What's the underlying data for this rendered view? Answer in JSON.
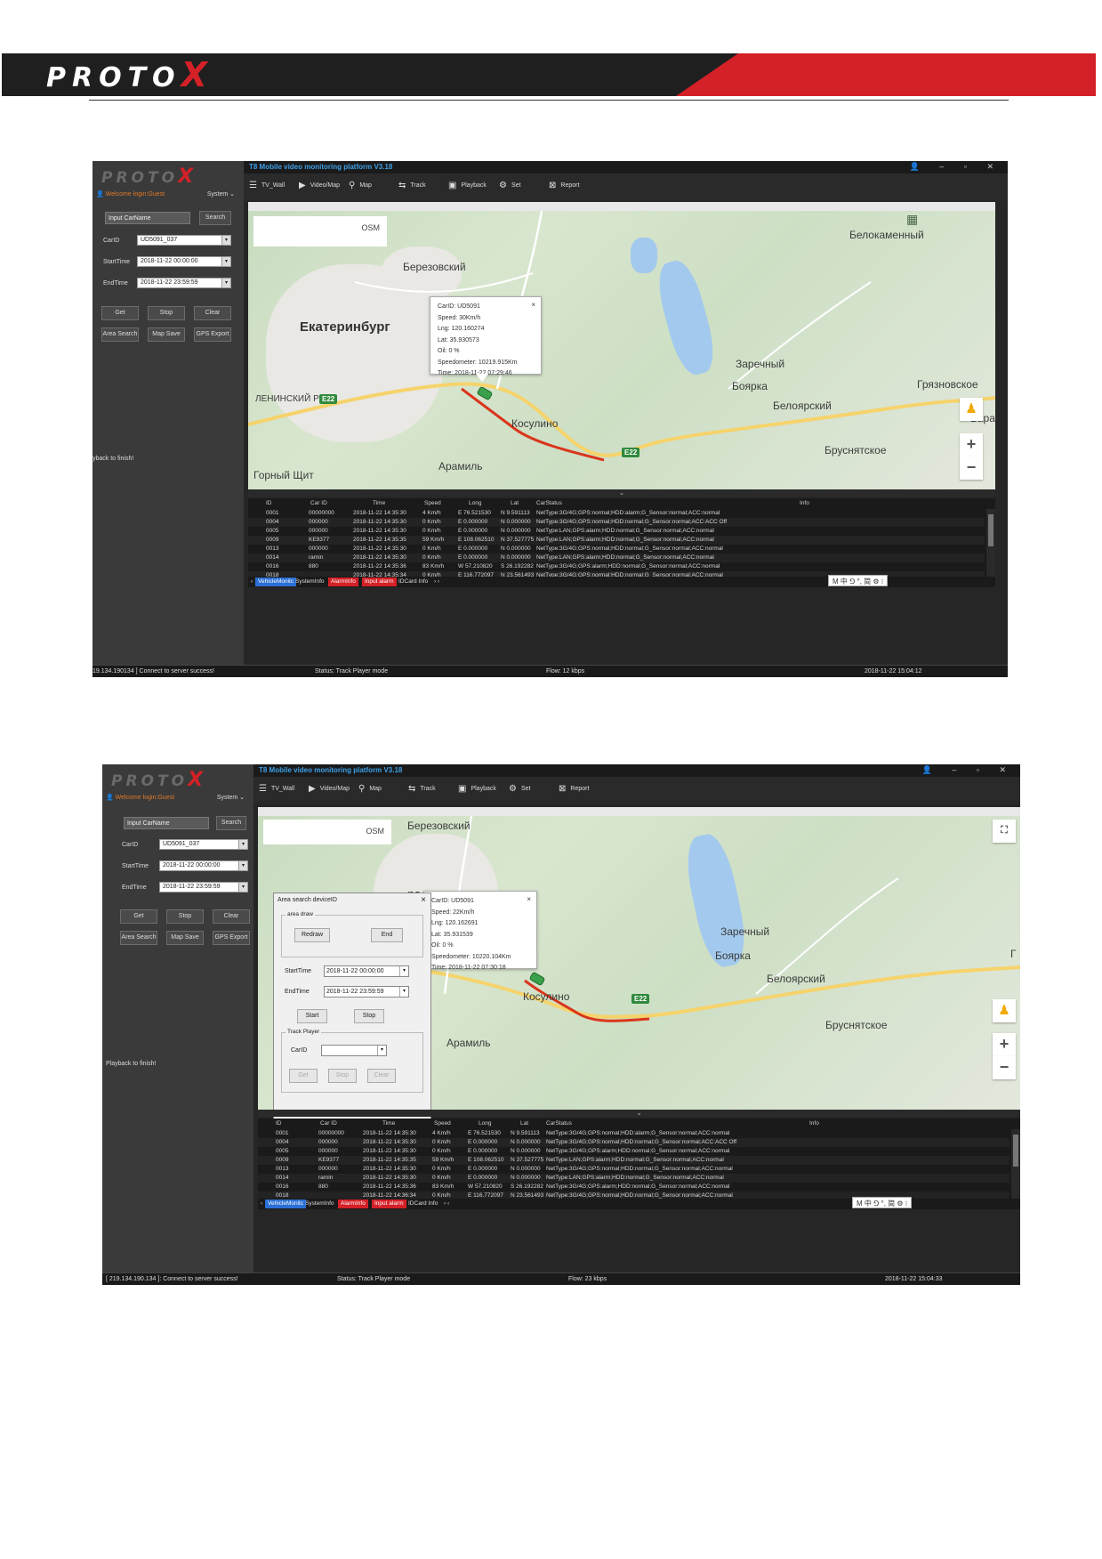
{
  "header": {
    "logo_text": "PROTO",
    "logo_x": "X"
  },
  "app": {
    "title": "T8 Mobile video monitoring platform V3.18",
    "logo_text": "PROTO",
    "logo_x": "X",
    "welcome": "Welcome login:Guest",
    "system_menu": "System",
    "search_placeholder": "Input CarName",
    "search_button": "Search",
    "car_id_label": "CarID",
    "start_time_label": "StartTime",
    "end_time_label": "EndTime",
    "car_id_value": "UD5091_037",
    "start_time_value": "2018-11-22 00:00:00",
    "end_time_value": "2018-11-22 23:59:59",
    "buttons": {
      "get": "Get",
      "stop": "Stop",
      "clear": "Clear",
      "area_search": "Area Search",
      "map_save": "Map Save",
      "gps_export": "GPS Export"
    },
    "toolbar": {
      "tv_wall": "TV_Wall",
      "video_map": "Video/Map",
      "map": "Map",
      "track": "Track",
      "playback": "Playback",
      "set": "Set",
      "report": "Report"
    },
    "map_source": "OSM",
    "table_headers": [
      "ID",
      "Car ID",
      "Time",
      "Speed",
      "Long",
      "Lat",
      "CarStatus",
      "Info"
    ],
    "tabs": [
      "VehicleMonitc",
      "SystemInfo",
      "AlarmInfo",
      "Input alarm",
      "IDCard Info"
    ],
    "ime": "M 中 ⅁ °, 简 ⚙ ⁝",
    "status_mode": "Status: Track Player mode"
  },
  "shot1": {
    "playback_msg": "yback to finish!",
    "server_msg": "19.134.190134 ] Connect to server success!",
    "flow": "Flow: 12 kbps",
    "datetime": "2018-11-22 15:04:12",
    "places": {
      "belokamenny": "Белокаменный",
      "berezovsky": "Березовский",
      "ekaterinburg": "Екатеринбург",
      "zarechny": "Заречный",
      "boyarka": "Боярка",
      "gryaznovskoe": "Грязновское",
      "leninsky": "ЛЕНИНСКИЙ Р-Н",
      "beloyarsky": "Белоярский",
      "kosulino": "Косулино",
      "bara": "Бара",
      "brusnyatskoe": "Бруснятское",
      "aramil": "Арамиль",
      "gorny_shchit": "Горный Щит"
    },
    "shields": {
      "e22a": "E22",
      "e22b": "E22"
    },
    "popup": {
      "car_id": "CarID:    UD5091",
      "speed": "Speed:  30Km/h",
      "lng": "Lng:  120.160274",
      "lat": "Lat:  35.930573",
      "oil": "Oil:  0 %",
      "speedometer": "Speedometer:  10219.915Km",
      "time": "Time:  2018-11-22 07:29:46"
    },
    "rows": [
      [
        "0001",
        "00000000",
        "2018-11-22 14:35:30",
        "4 Km/h",
        "E 76.521530",
        "N 9.591113",
        "NetType:3G/4G;GPS:normal;HDD:alarm;G_Sensor:normal;ACC:normal"
      ],
      [
        "0004",
        "000000",
        "2018-11-22 14:35:30",
        "0 Km/h",
        "E 0.000000",
        "N 0.000000",
        "NetType:3G/4G;GPS:normal;HDD:normal;G_Sensor:normal;ACC:ACC Off"
      ],
      [
        "0005",
        "000000",
        "2018-11-22 14:35:30",
        "0 Km/h",
        "E 0.000000",
        "N 0.000000",
        "NetType:LAN;GPS:alarm;HDD:normal;G_Sensor:normal;ACC:normal"
      ],
      [
        "0009",
        "KE9377",
        "2018-11-22 14:35:35",
        "59 Km/h",
        "E 108.062510",
        "N 37.527775",
        "NetType:LAN;GPS:alarm;HDD:normal;G_Sensor:normal;ACC:normal"
      ],
      [
        "0013",
        "000000",
        "2018-11-22 14:35:30",
        "0 Km/h",
        "E 0.000000",
        "N 0.000000",
        "NetType:3G/4G;GPS:normal;HDD:normal;G_Sensor:normal;ACC:normal"
      ],
      [
        "0014",
        "ramin",
        "2018-11-22 14:35:30",
        "0 Km/h",
        "E 0.000000",
        "N 0.000000",
        "NetType:LAN;GPS:alarm;HDD:normal;G_Sensor:normal;ACC:normal"
      ],
      [
        "0016",
        "880",
        "2018-11-22 14:35:36",
        "83 Km/h",
        "W 57.210820",
        "S 26.192282",
        "NetType:3G/4G;GPS:alarm;HDD:normal;G_Sensor:normal;ACC:normal"
      ],
      [
        "0018",
        "",
        "2018-11-22 14:35:34",
        "0 Km/h",
        "E 116.772097",
        "N 23.561493",
        "NetType:3G/4G;GPS:normal;HDD:normal;G_Sensor:normal;ACC:normal"
      ]
    ]
  },
  "shot2": {
    "playback_msg": "Playback to finish!",
    "server_msg": "[ 219.134.190.134 ]: Connect to server success!",
    "flow": "Flow: 23 kbps",
    "datetime": "2018-11-22 15:04:33",
    "places": {
      "berezovsky": "Березовский",
      "zarechny": "Заречный",
      "boyarka": "Боярка",
      "beloyarsky": "Белоярский",
      "kosulino": "Косулино",
      "brusnyatskoe": "Бруснятское",
      "aramil": "Арамиль",
      "partial_r": "рг",
      "edge_g": "Г"
    },
    "shields": {
      "e22": "E22"
    },
    "popup": {
      "car_id": "CarID:    UD5091",
      "speed": "Speed:  22Km/h",
      "lng": "Lng:  120.162691",
      "lat": "Lat:  35.931539",
      "oil": "Oil:  0 %",
      "speedometer": "Speedometer:  10220.104Km",
      "time": "Time:  2018-11-22 07:30:18"
    },
    "dialog": {
      "title": "Area search deviceID",
      "area_draw": "area draw",
      "redraw": "Redraw",
      "end": "End",
      "start_time_label": "StartTime",
      "end_time_label": "EndTime",
      "start_time": "2018-11-22 00:00:00",
      "end_time": "2018-11-22 23:59:59",
      "start": "Start",
      "stop": "Stop",
      "track_player": "Track Player",
      "car_id_label": "CarID",
      "get": "Get",
      "stop2": "Stop",
      "clear": "Clear"
    },
    "rows": [
      [
        "0001",
        "00000000",
        "2018-11-22 14:35:30",
        "4 Km/h",
        "E 76.521530",
        "N 9.591113",
        "NetType:3G/4G;GPS:normal;HDD:alarm;G_Sensor:normal;ACC:normal"
      ],
      [
        "0004",
        "000000",
        "2018-11-22 14:35:30",
        "0 Km/h",
        "E 0.000000",
        "N 0.000000",
        "NetType:3G/4G;GPS:normal;HDD:normal;G_Sensor:normal;ACC:ACC Off"
      ],
      [
        "0005",
        "000000",
        "2018-11-22 14:35:30",
        "0 Km/h",
        "E 0.000000",
        "N 0.000000",
        "NetType:3G/4G;GPS:alarm;HDD:normal;G_Sensor:normal;ACC:normal"
      ],
      [
        "0009",
        "KE9377",
        "2018-11-22 14:35:35",
        "59 Km/h",
        "E 108.062510",
        "N 37.527775",
        "NetType:LAN;GPS:alarm;HDD:normal;G_Sensor:normal;ACC:normal"
      ],
      [
        "0013",
        "000000",
        "2018-11-22 14:35:30",
        "0 Km/h",
        "E 0.000000",
        "N 0.000000",
        "NetType:3G/4G;GPS:normal;HDD:normal;G_Sensor:normal;ACC:normal"
      ],
      [
        "0014",
        "ramin",
        "2018-11-22 14:35:30",
        "0 Km/h",
        "E 0.000000",
        "N 0.000000",
        "NetType:LAN;GPS:alarm;HDD:normal;G_Sensor:normal;ACC:normal"
      ],
      [
        "0016",
        "880",
        "2018-11-22 14:35:36",
        "83 Km/h",
        "W 57.210820",
        "S 26.192282",
        "NetType:3G/4G;GPS:alarm;HDD:normal;G_Sensor:normal;ACC:normal"
      ],
      [
        "0018",
        "",
        "2018-11-22 14:36:34",
        "0 Km/h",
        "E 116.772097",
        "N 23.561493",
        "NetType:3G/4G;GPS:normal;HDD:normal;G_Sensor:normal;ACC:normal"
      ]
    ]
  }
}
